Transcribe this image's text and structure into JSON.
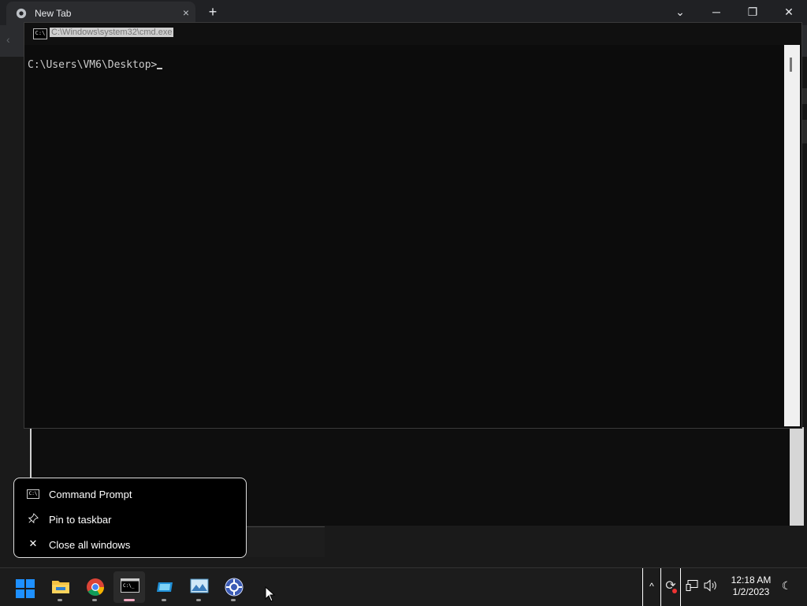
{
  "chrome": {
    "tab_title": "New Tab",
    "tab_close": "×",
    "new_tab": "+",
    "tab_search": "⌄",
    "minimize": "─",
    "restore": "❐",
    "close": "✕"
  },
  "cmd_window": {
    "title": "C:\\Windows\\system32\\cmd.exe",
    "icon_text": "C:\\",
    "prompt": "C:\\Users\\VM6\\Desktop>"
  },
  "jump_list": {
    "items": [
      {
        "label": "Command Prompt",
        "icon": "cmd-icon"
      },
      {
        "label": "Pin to taskbar",
        "icon": "pin-icon"
      },
      {
        "label": "Close all windows",
        "icon": "close-icon"
      }
    ]
  },
  "taskbar": {
    "apps": [
      {
        "name": "start",
        "icon": "windows-start-icon"
      },
      {
        "name": "file-explorer",
        "icon": "folder-icon"
      },
      {
        "name": "chrome",
        "icon": "chrome-icon"
      },
      {
        "name": "command-prompt",
        "icon": "terminal-icon",
        "active": true
      },
      {
        "name": "app-5",
        "icon": "drive-icon"
      },
      {
        "name": "app-6",
        "icon": "image-viewer-icon"
      },
      {
        "name": "app-7",
        "icon": "settings-wheel-icon"
      }
    ],
    "tray": {
      "overflow": "^",
      "time": "12:18 AM",
      "date": "1/2/2023"
    }
  },
  "colors": {
    "taskbar_bg": "#1c1c1c",
    "cmd_bg": "#0c0c0c",
    "accent_start": "#1e90ff"
  }
}
